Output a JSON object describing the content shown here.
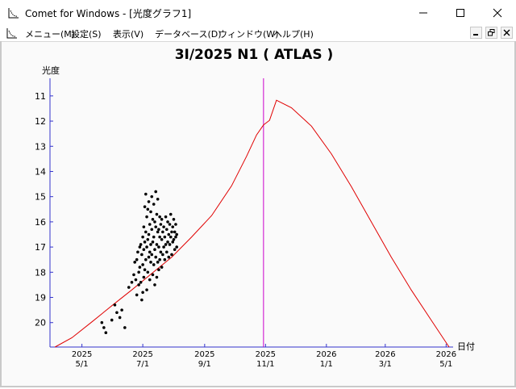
{
  "window": {
    "title": "Comet for Windows - [光度グラフ1]",
    "app_icon": "graph-icon",
    "controls": {
      "minimize": "minimize-icon",
      "maximize": "maximize-icon",
      "close": "close-icon"
    }
  },
  "menu": {
    "items": [
      {
        "label": "メニュー(M)"
      },
      {
        "label": "設定(S)"
      },
      {
        "label": "表示(V)"
      },
      {
        "label": "データベース(D)"
      },
      {
        "label": "ウィンドウ(W)"
      },
      {
        "label": "ヘルプ(H)"
      }
    ],
    "mdi_controls": {
      "minimize": "child-minimize-icon",
      "restore": "child-restore-icon",
      "close": "child-close-icon"
    }
  },
  "chart_data": {
    "type": "line",
    "title": "3I/2025 N1 ( ATLAS )",
    "ylabel": "光度",
    "xlabel": "日付",
    "y_inverted": true,
    "ylim": [
      20.97,
      10.3
    ],
    "y_ticks": [
      11,
      12,
      13,
      14,
      15,
      16,
      17,
      18,
      19,
      20
    ],
    "x_ticks": [
      {
        "year": "2025",
        "date": "5/1",
        "day": 0
      },
      {
        "year": "2025",
        "date": "7/1",
        "day": 61
      },
      {
        "year": "2025",
        "date": "9/1",
        "day": 123
      },
      {
        "year": "2025",
        "date": "11/1",
        "day": 184
      },
      {
        "year": "2026",
        "date": "1/1",
        "day": 245
      },
      {
        "year": "2026",
        "date": "3/1",
        "day": 304
      },
      {
        "year": "2026",
        "date": "5/1",
        "day": 365
      }
    ],
    "current_date_marker": {
      "day": 182,
      "color": "#cc00cc"
    },
    "colors": {
      "predicted": "#e00000",
      "observed": "#000000",
      "axis": "#3333cc",
      "marker": "#cc00cc"
    },
    "series": [
      {
        "type": "line",
        "x": [
          -27,
          -10,
          10,
          30,
          50,
          70,
          90,
          110,
          130,
          150,
          165,
          175,
          182,
          188,
          195,
          210,
          230,
          250,
          270,
          290,
          310,
          330,
          350,
          368
        ],
        "y": [
          21.13,
          20.6,
          19.97,
          19.33,
          18.7,
          18.05,
          17.4,
          16.6,
          15.75,
          14.57,
          13.4,
          12.55,
          12.15,
          11.97,
          11.17,
          11.47,
          12.2,
          13.3,
          14.6,
          16.0,
          17.4,
          18.7,
          19.9,
          20.97
        ]
      },
      {
        "type": "scatter",
        "x": [
          20,
          22,
          24,
          30,
          33,
          35,
          38,
          40,
          43,
          47,
          50,
          52,
          53,
          54,
          55,
          55,
          56,
          57,
          57,
          58,
          58,
          59,
          59,
          60,
          60,
          61,
          61,
          61,
          62,
          62,
          62,
          63,
          63,
          63,
          64,
          64,
          64,
          65,
          65,
          65,
          66,
          66,
          66,
          67,
          67,
          67,
          68,
          68,
          68,
          69,
          69,
          69,
          70,
          70,
          70,
          71,
          71,
          71,
          72,
          72,
          72,
          73,
          73,
          73,
          74,
          74,
          74,
          75,
          75,
          75,
          76,
          76,
          76,
          77,
          77,
          77,
          78,
          78,
          78,
          79,
          79,
          80,
          80,
          80,
          81,
          81,
          82,
          82,
          83,
          83,
          84,
          84,
          85,
          85,
          86,
          86,
          87,
          87,
          88,
          88,
          89,
          89,
          90,
          90,
          91,
          91,
          92,
          92,
          93,
          93,
          94,
          94,
          95,
          95
        ],
        "y": [
          20.0,
          20.2,
          20.4,
          19.9,
          19.3,
          19.6,
          19.8,
          19.5,
          20.2,
          18.6,
          18.4,
          18.1,
          17.6,
          18.3,
          17.5,
          18.9,
          17.2,
          18.0,
          18.5,
          17.0,
          17.8,
          16.9,
          18.4,
          17.3,
          19.1,
          16.6,
          17.7,
          18.8,
          16.2,
          17.1,
          18.2,
          15.4,
          16.8,
          17.9,
          14.9,
          16.4,
          17.5,
          15.8,
          17.0,
          18.7,
          15.5,
          16.7,
          18.0,
          15.2,
          16.5,
          17.4,
          16.1,
          17.2,
          18.3,
          15.6,
          16.9,
          17.6,
          15.0,
          16.3,
          17.3,
          15.9,
          16.8,
          18.1,
          15.3,
          16.6,
          17.7,
          16.0,
          17.1,
          18.5,
          14.8,
          16.2,
          17.4,
          15.7,
          16.9,
          18.2,
          15.1,
          16.4,
          17.6,
          16.3,
          17.0,
          17.9,
          15.8,
          16.6,
          17.5,
          16.1,
          17.2,
          15.9,
          16.7,
          17.8,
          16.4,
          17.3,
          16.2,
          17.0,
          16.6,
          17.5,
          15.8,
          16.9,
          16.3,
          17.2,
          16.0,
          16.8,
          16.5,
          17.4,
          16.1,
          16.9,
          15.7,
          16.6,
          16.4,
          17.3,
          16.2,
          16.8,
          15.9,
          16.7,
          16.4,
          17.1,
          16.1,
          16.6,
          16.5,
          17.0
        ]
      }
    ]
  }
}
